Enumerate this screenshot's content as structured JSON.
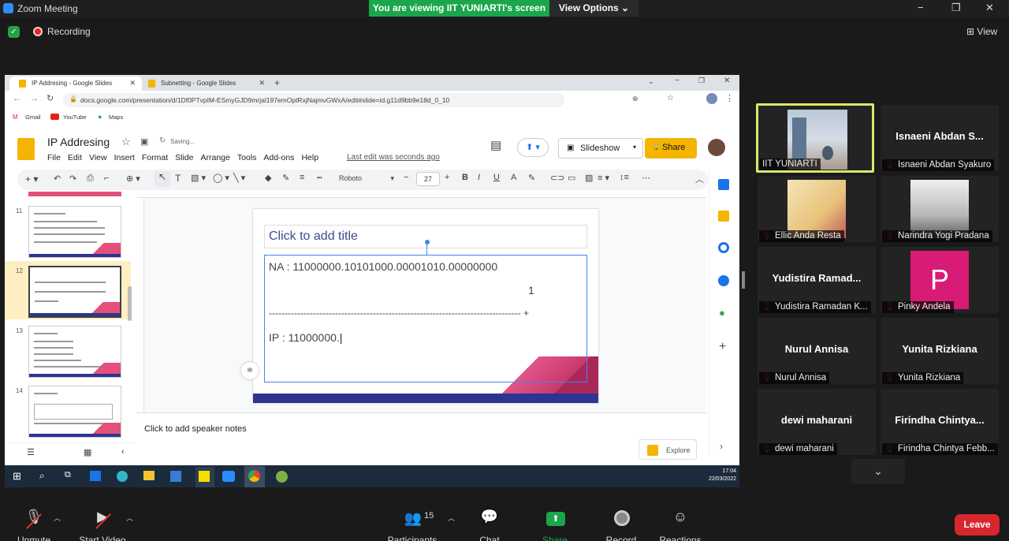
{
  "zoom": {
    "title": "Zoom Meeting",
    "banner": "You are viewing IIT YUNIARTI's screen",
    "view_options": "View Options",
    "recording": "Recording",
    "view": "View",
    "window_controls": [
      "−",
      "❐",
      "✕"
    ]
  },
  "browser": {
    "tabs": [
      {
        "label": "IP Addresing - Google Slides",
        "active": true
      },
      {
        "label": "Subnetting - Google Slides",
        "active": false
      }
    ],
    "url": "docs.google.com/presentation/d/1Df0PTvpIM-ESmyGJD9mrjal197emOptRxjNajmvGWxA/edit#slide=id.g11d9bb9e18d_0_10",
    "bookmarks": [
      "Gmail",
      "YouTube",
      "Maps"
    ]
  },
  "slides": {
    "title": "IP Addresing",
    "saving": "Saving...",
    "menus": [
      "File",
      "Edit",
      "View",
      "Insert",
      "Format",
      "Slide",
      "Arrange",
      "Tools",
      "Add-ons",
      "Help"
    ],
    "last_edit": "Last edit was seconds ago",
    "slideshow": "Slideshow",
    "share": "Share",
    "font": "Roboto",
    "font_size": "27",
    "thumb_numbers": [
      "11",
      "12",
      "13",
      "14"
    ],
    "title_placeholder": "Click to add title",
    "lines": {
      "na": "NA : 11000000.10101000.00001010.00000000",
      "one": "1",
      "dashes": "-------------------------------------------------------------------------------- +",
      "ip": "IP : 11000000."
    },
    "notes": "Click to add speaker notes",
    "explore": "Explore"
  },
  "taskbar": {
    "time": "17:04",
    "date": "22/03/2022"
  },
  "participants": [
    {
      "name": "IIT YUNIARTI",
      "label": "IIT YUNIARTI",
      "active": true,
      "muted": false,
      "kind": "video"
    },
    {
      "name": "Isnaeni Abdan S...",
      "label": "Isnaeni Abdan Syakuro",
      "kind": "text"
    },
    {
      "name": "",
      "label": "Ellic Anda Resta",
      "kind": "anime"
    },
    {
      "name": "",
      "label": "Narindra Yogi Pradana",
      "kind": "anime2"
    },
    {
      "name": "Yudistira Ramad...",
      "label": "Yudistira Ramadan K...",
      "kind": "text"
    },
    {
      "name": "P",
      "label": "Pinky Andela",
      "kind": "avatar"
    },
    {
      "name": "Nurul Annisa",
      "label": "Nurul Annisa",
      "kind": "text"
    },
    {
      "name": "Yunita Rizkiana",
      "label": "Yunita Rizkiana",
      "kind": "text"
    },
    {
      "name": "dewi maharani",
      "label": "dewi maharani",
      "kind": "text"
    },
    {
      "name": "Firindha Chintya...",
      "label": "Firindha Chintya Febb...",
      "kind": "text"
    }
  ],
  "controls": {
    "unmute": "Unmute",
    "start_video": "Start Video",
    "participants": "Participants",
    "participants_count": "15",
    "chat": "Chat",
    "share_screen": "Share Screen",
    "record": "Record",
    "reactions": "Reactions",
    "leave": "Leave"
  },
  "colors": {
    "banner": "#1aa64a",
    "leave": "#d8262d",
    "active_tile": "#d9e86a",
    "slide_accent": "#e0548a",
    "slide_bar": "#2d3491"
  }
}
